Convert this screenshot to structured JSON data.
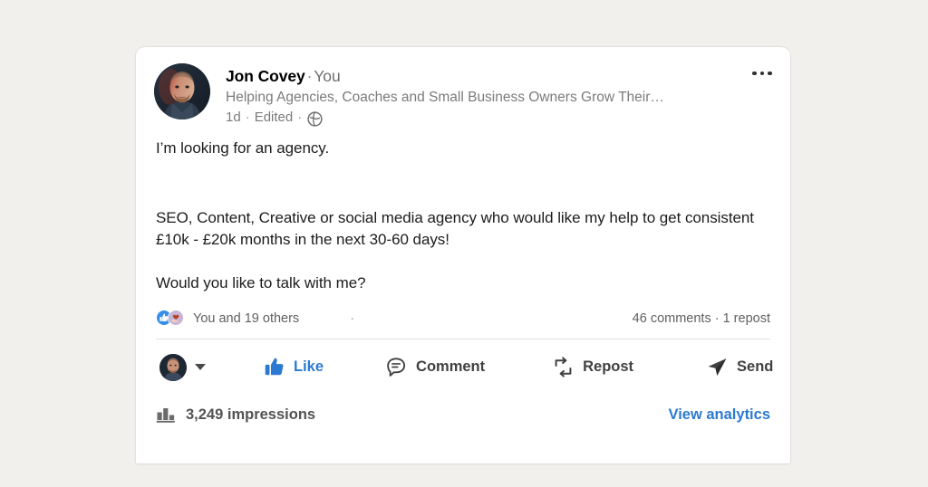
{
  "theme": {
    "page_background": "#f2f0ec",
    "card_background": "#ffffff",
    "accent_blue": "#2b7ad1",
    "text_primary": "#1c1c1c",
    "text_muted": "#7b7b7b"
  },
  "post": {
    "author": {
      "name": "Jon Covey",
      "separator": "·",
      "relationship": "You",
      "headline": "Helping Agencies, Coaches and Small Business Owners Grow Their…",
      "avatar_name": "jon-covey-avatar"
    },
    "meta": {
      "age": "1d",
      "dot1": "·",
      "edited": "Edited",
      "dot2": "·",
      "visibility_icon": "globe-icon"
    },
    "more_options_label": "…",
    "content": {
      "paragraph_1": "I’m looking for an agency.",
      "paragraph_2": "SEO, Content, Creative or social media agency who would like my help to get consistent £10k - £20k months in the next 30-60 days!",
      "paragraph_3": "Would you like to talk with me?"
    },
    "social": {
      "reaction_icons": [
        "like-reaction-icon",
        "support-reaction-icon"
      ],
      "reactors": "You and 19 others",
      "separator": "·",
      "counts": "46 comments · 1 repost"
    },
    "actions": {
      "actor_avatar_name": "actor-avatar",
      "actor_dropdown_name": "actor-dropdown-caret",
      "items": [
        {
          "id": "like",
          "label": "Like",
          "icon": "thumbs-up-icon",
          "active": true
        },
        {
          "id": "comment",
          "label": "Comment",
          "icon": "comment-bubble-icon",
          "active": false
        },
        {
          "id": "repost",
          "label": "Repost",
          "icon": "repost-arrows-icon",
          "active": false
        },
        {
          "id": "send",
          "label": "Send",
          "icon": "paper-plane-icon",
          "active": false
        }
      ]
    },
    "analytics": {
      "icon": "bar-chart-icon",
      "impressions": "3,249 impressions",
      "link_label": "View analytics"
    }
  }
}
